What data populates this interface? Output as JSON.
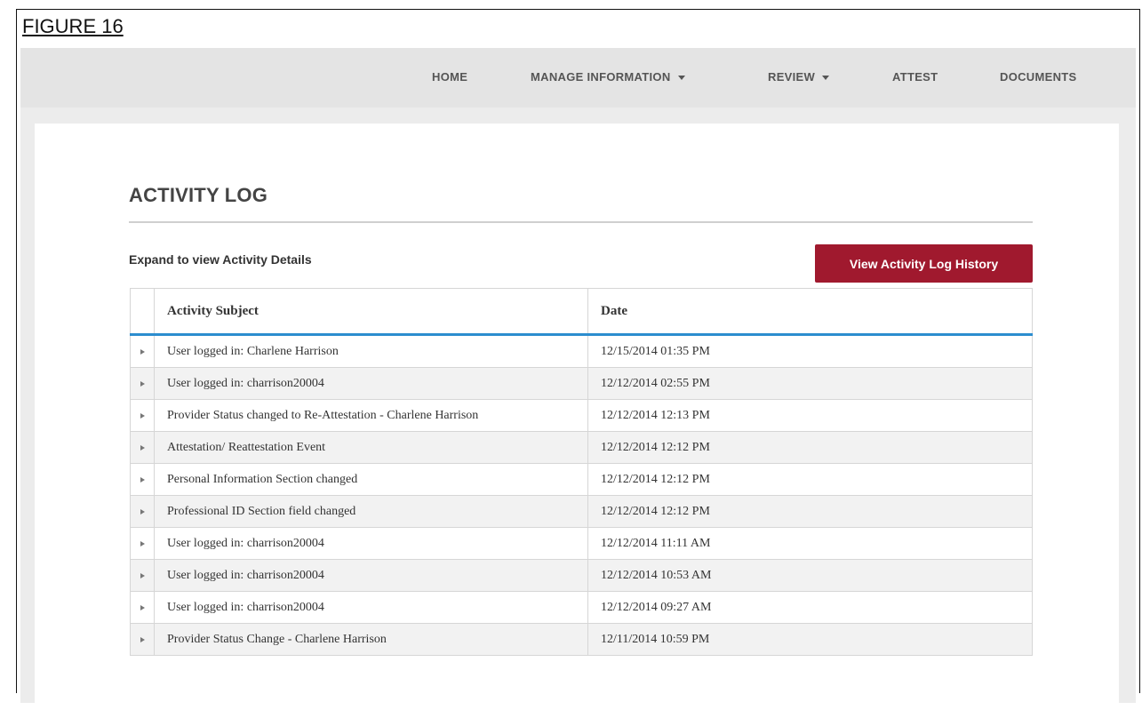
{
  "figure_label": "FIGURE 16",
  "nav": {
    "items": [
      {
        "label": "HOME",
        "dropdown": false
      },
      {
        "label": "MANAGE INFORMATION",
        "dropdown": true
      },
      {
        "label": "REVIEW",
        "dropdown": true
      },
      {
        "label": "ATTEST",
        "dropdown": false
      },
      {
        "label": "DOCUMENTS",
        "dropdown": false
      }
    ]
  },
  "page": {
    "title": "ACTIVITY LOG",
    "expand_hint": "Expand to view Activity Details",
    "history_button": "View Activity Log History"
  },
  "table": {
    "headers": [
      "Activity Subject",
      "Date"
    ],
    "rows": [
      {
        "subject": "User logged in: Charlene Harrison",
        "date": "12/15/2014 01:35 PM"
      },
      {
        "subject": "User logged in: charrison20004",
        "date": "12/12/2014 02:55 PM"
      },
      {
        "subject": "Provider Status changed to Re-Attestation - Charlene Harrison",
        "date": "12/12/2014 12:13 PM"
      },
      {
        "subject": "Attestation/ Reattestation Event",
        "date": "12/12/2014 12:12 PM"
      },
      {
        "subject": "Personal Information Section changed",
        "date": "12/12/2014 12:12 PM"
      },
      {
        "subject": "Professional ID Section field changed",
        "date": "12/12/2014 12:12 PM"
      },
      {
        "subject": "User logged in: charrison20004",
        "date": "12/12/2014 11:11 AM"
      },
      {
        "subject": "User logged in: charrison20004",
        "date": "12/12/2014 10:53 AM"
      },
      {
        "subject": "User logged in: charrison20004",
        "date": "12/12/2014 09:27 AM"
      },
      {
        "subject": "Provider Status Change - Charlene Harrison",
        "date": "12/11/2014 10:59 PM"
      }
    ]
  },
  "colors": {
    "accent_button": "#a0192e",
    "header_rule": "#2c8dcf",
    "nav_bg": "#e4e4e4"
  }
}
